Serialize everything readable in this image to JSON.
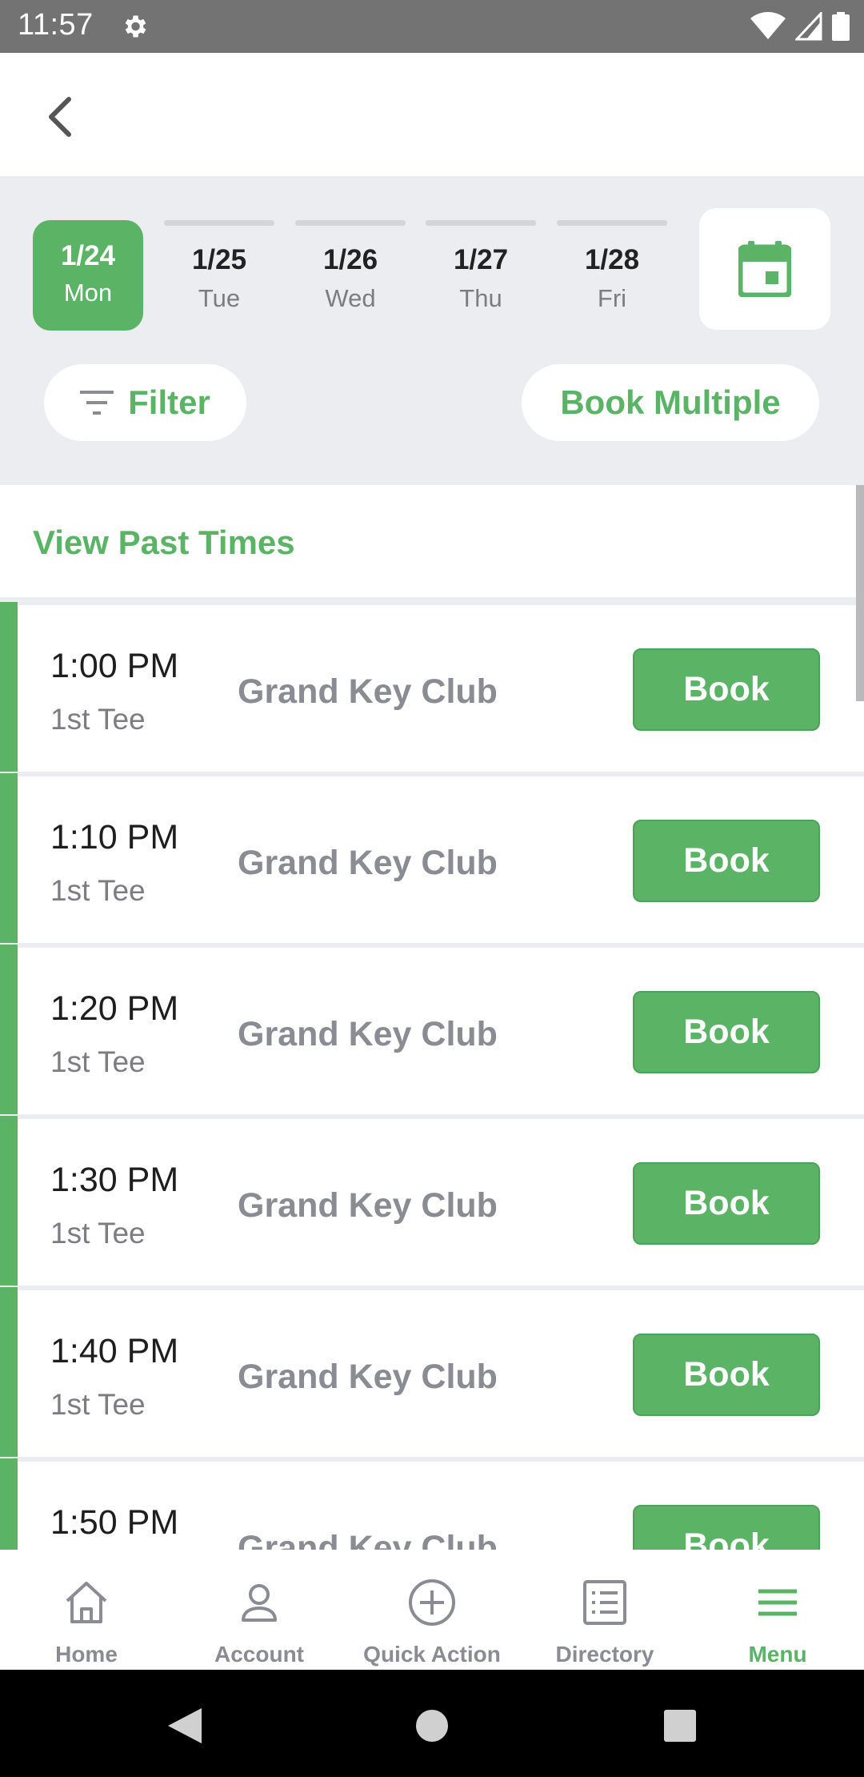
{
  "status_bar": {
    "time": "11:57"
  },
  "dates": [
    {
      "date": "1/24",
      "weekday": "Mon",
      "selected": true
    },
    {
      "date": "1/25",
      "weekday": "Tue",
      "selected": false
    },
    {
      "date": "1/26",
      "weekday": "Wed",
      "selected": false
    },
    {
      "date": "1/27",
      "weekday": "Thu",
      "selected": false
    },
    {
      "date": "1/28",
      "weekday": "Fri",
      "selected": false
    }
  ],
  "actions": {
    "filter_label": "Filter",
    "book_multiple_label": "Book Multiple"
  },
  "list": {
    "view_past_label": "View Past Times",
    "tee_times": [
      {
        "time": "1:00 PM",
        "tee": "1st Tee",
        "club": "Grand Key Club",
        "button": "Book"
      },
      {
        "time": "1:10 PM",
        "tee": "1st Tee",
        "club": "Grand Key Club",
        "button": "Book"
      },
      {
        "time": "1:20 PM",
        "tee": "1st Tee",
        "club": "Grand Key Club",
        "button": "Book"
      },
      {
        "time": "1:30 PM",
        "tee": "1st Tee",
        "club": "Grand Key Club",
        "button": "Book"
      },
      {
        "time": "1:40 PM",
        "tee": "1st Tee",
        "club": "Grand Key Club",
        "button": "Book"
      },
      {
        "time": "1:50 PM",
        "tee": "",
        "club": "Grand Key Club",
        "button": "Book"
      }
    ]
  },
  "bottom_nav": [
    {
      "label": "Home",
      "icon": "home-icon",
      "active": false
    },
    {
      "label": "Account",
      "icon": "account-icon",
      "active": false
    },
    {
      "label": "Quick Action",
      "icon": "plus-circle-icon",
      "active": false
    },
    {
      "label": "Directory",
      "icon": "directory-icon",
      "active": false
    },
    {
      "label": "Menu",
      "icon": "menu-icon",
      "active": true
    }
  ],
  "colors": {
    "accent": "#5bb466",
    "panel": "#ecedf0",
    "muted_text": "#8a8b93"
  }
}
